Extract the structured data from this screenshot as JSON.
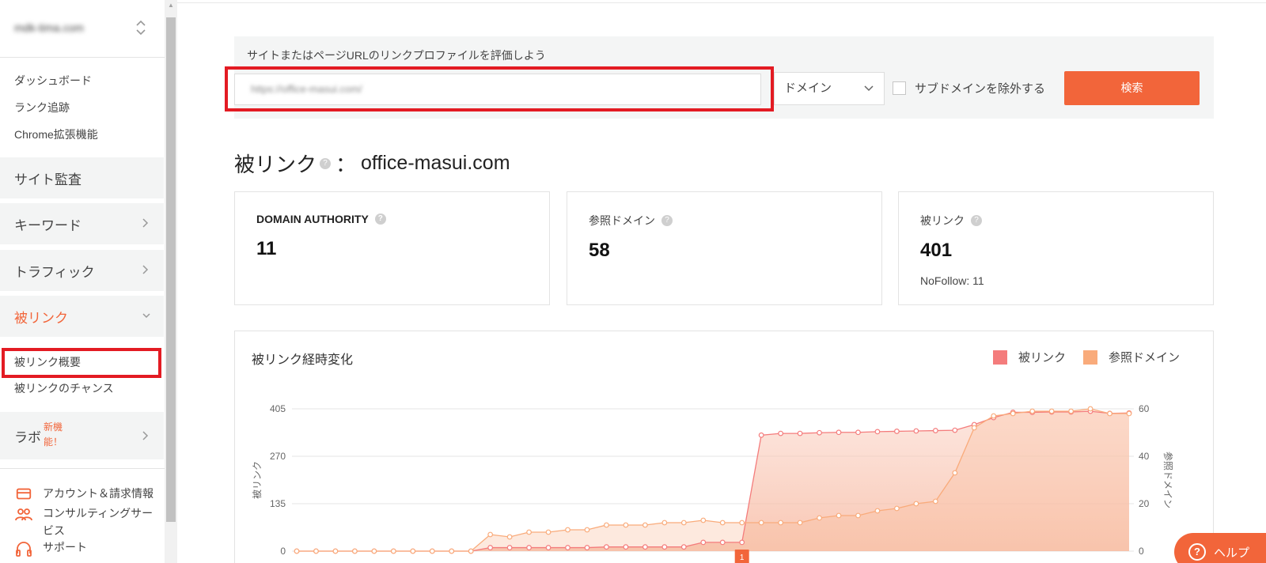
{
  "sidebar": {
    "site_name": "mdk-tima.com",
    "links": [
      "ダッシュボード",
      "ランク追跡",
      "Chrome拡張機能"
    ],
    "site_audit": "サイト監査",
    "keywords": "キーワード",
    "traffic": "トラフィック",
    "backlinks": "被リンク",
    "backlinks_sub": [
      "被リンク概要",
      "被リンクのチャンス"
    ],
    "labo": "ラボ",
    "labo_badge_line1": "新機",
    "labo_badge_line2": "能！",
    "account": "アカウント＆請求情報",
    "consulting_line1": "コンサルティングサー",
    "consulting_line2": "ビス",
    "support": "サポート"
  },
  "search": {
    "title": "サイトまたはページURLのリンクプロファイルを評価しよう",
    "url_value": "https://office-masui.com/",
    "scope": "ドメイン",
    "exclude_subdomains": "サブドメインを除外する",
    "button": "検索"
  },
  "heading": {
    "title": "被リンク",
    "colon": "：",
    "domain": "office-masui.com"
  },
  "cards": {
    "da_label": "DOMAIN AUTHORITY",
    "da_value": "11",
    "ref_label": "参照ドメイン",
    "ref_value": "58",
    "bl_label": "被リンク",
    "bl_value": "401",
    "nofollow": "NoFollow: 11"
  },
  "chart_data": {
    "type": "area",
    "title": "被リンク経時変化",
    "legend_position": "top-right",
    "ylabel_left": "被リンク",
    "ylabel_right": "参照ドメイン",
    "y_left_ticks": [
      "405",
      "270",
      "135",
      "0"
    ],
    "y_right_ticks": [
      "60",
      "40",
      "20",
      "0"
    ],
    "ylim_left": [
      0,
      405
    ],
    "ylim_right": [
      0,
      60
    ],
    "grid": true,
    "marker_label": "1",
    "marker_index": 23,
    "series": [
      {
        "name": "被リンク",
        "color": "#f47c7c",
        "axis": "left",
        "values": [
          0,
          0,
          0,
          0,
          0,
          0,
          0,
          0,
          0,
          0,
          10,
          10,
          10,
          10,
          10,
          10,
          12,
          12,
          12,
          12,
          12,
          25,
          25,
          25,
          330,
          335,
          335,
          337,
          338,
          338,
          340,
          341,
          342,
          343,
          344,
          360,
          380,
          395,
          395,
          396,
          396,
          398,
          392,
          393
        ]
      },
      {
        "name": "参照ドメイン",
        "color": "#f9ab7b",
        "axis": "right",
        "values": [
          0,
          0,
          0,
          0,
          0,
          0,
          0,
          0,
          0,
          0,
          7,
          6,
          8,
          8,
          9,
          9,
          11,
          11,
          11,
          12,
          12,
          13,
          12,
          12,
          12,
          12,
          12,
          14,
          15,
          15,
          17,
          18,
          20,
          21,
          33,
          52,
          57,
          58,
          59,
          59,
          59,
          60,
          58,
          58
        ]
      }
    ]
  },
  "help": "ヘルプ",
  "colors": {
    "accent": "#f2653a",
    "highlight": "#e31b23"
  }
}
